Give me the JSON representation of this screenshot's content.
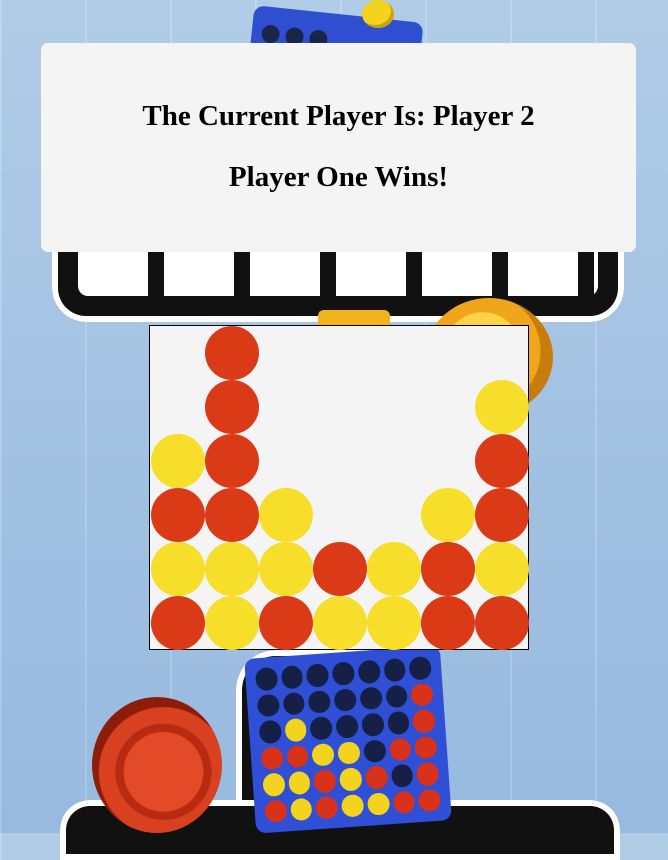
{
  "status": {
    "current_player_text": "The Current Player Is: Player 2",
    "winner_text": "Player One Wins!"
  },
  "board": {
    "columns": 7,
    "rows": 6,
    "colors": {
      "red": "#db3a16",
      "yellow": "#f7de2a",
      "empty": "transparent"
    },
    "grid": [
      [
        "",
        "R",
        "",
        "",
        "",
        "",
        ""
      ],
      [
        "",
        "R",
        "",
        "",
        "",
        "",
        "Y"
      ],
      [
        "Y",
        "R",
        "",
        "",
        "",
        "",
        "R"
      ],
      [
        "R",
        "R",
        "Y",
        "",
        "",
        "Y",
        "R"
      ],
      [
        "Y",
        "Y",
        "Y",
        "R",
        "Y",
        "R",
        "Y"
      ],
      [
        "R",
        "Y",
        "R",
        "Y",
        "Y",
        "R",
        "R"
      ]
    ]
  },
  "background": {
    "theme": "connect-four-artwork",
    "colors": {
      "wood": "#a9c9ea",
      "rack": "#2e4fd6",
      "checker_red": "#d8321a",
      "coin_gold": "#f0a61a"
    }
  }
}
